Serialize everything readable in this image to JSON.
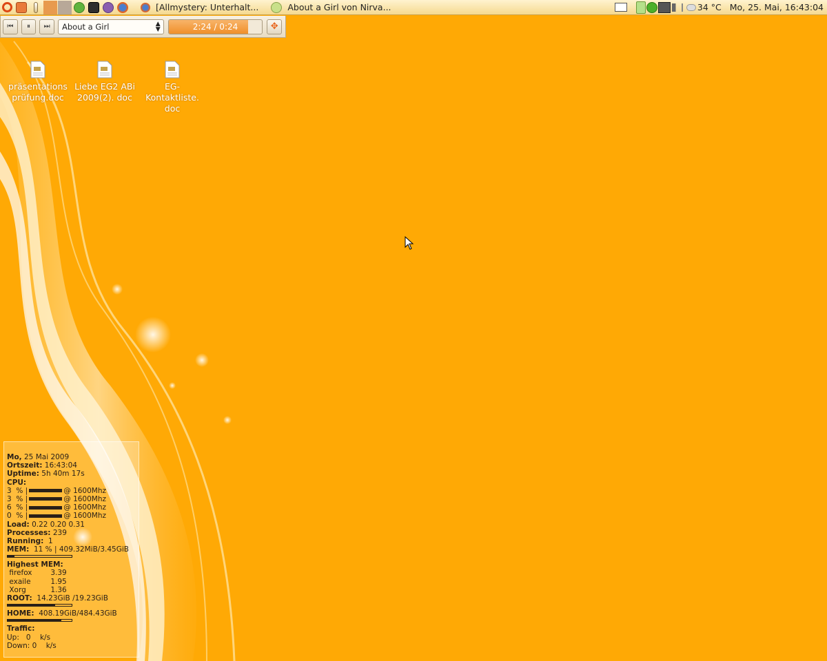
{
  "panel": {
    "tasks": [
      {
        "label": "[Allmystery: Unterhalt..."
      },
      {
        "label": "About a Girl von Nirva..."
      }
    ],
    "weather": "34 °C",
    "clock": "Mo, 25. Mai, 16:43:04"
  },
  "player": {
    "track": "About a Girl",
    "time": "2:24 / 0:24",
    "progress_fraction": 0.85
  },
  "desktop_icons": [
    {
      "label": "präsentations prüfung.doc"
    },
    {
      "label": "Liebe EG2 ABi 2009(2). doc"
    },
    {
      "label": "EG- Kontaktliste. doc"
    }
  ],
  "conky": {
    "date_key": "Mo,",
    "date_val": "25 Mai 2009",
    "time_key": "Ortszeit:",
    "time_val": "16:43:04",
    "uptime_key": "Uptime:",
    "uptime_val": "5h 40m 17s",
    "cpu_key": "CPU:",
    "cpus": [
      {
        "pct": "3  %",
        "freq": "@ 1600Mhz"
      },
      {
        "pct": "3  %",
        "freq": "@ 1600Mhz"
      },
      {
        "pct": "6  %",
        "freq": "@ 1600Mhz"
      },
      {
        "pct": "0  %",
        "freq": "@ 1600Mhz"
      }
    ],
    "load_key": "Load:",
    "load_val": "0.22 0.20 0.31",
    "proc_key": "Processes:",
    "proc_val": "239",
    "running_key": "Running:",
    "running_val": "1",
    "mem_key": "MEM:",
    "mem_val": "11 % | 409.32MiB/3.45GiB",
    "mem_fraction": 0.11,
    "highest_key": "Highest MEM:",
    "procs": [
      {
        "name": "firefox",
        "val": "3.39"
      },
      {
        "name": "exaile",
        "val": "1.95"
      },
      {
        "name": "Xorg",
        "val": "1.36"
      }
    ],
    "root_key": "ROOT:",
    "root_val": "14.23GiB /19.23GiB",
    "root_fraction": 0.74,
    "home_key": "HOME:",
    "home_val": "408.19GiB/484.43GiB",
    "home_fraction": 0.84,
    "traffic_key": "Traffic:",
    "up_key": "Up:",
    "up_val": "0",
    "up_unit": "k/s",
    "down_key": "Down:",
    "down_val": "0",
    "down_unit": "k/s"
  }
}
